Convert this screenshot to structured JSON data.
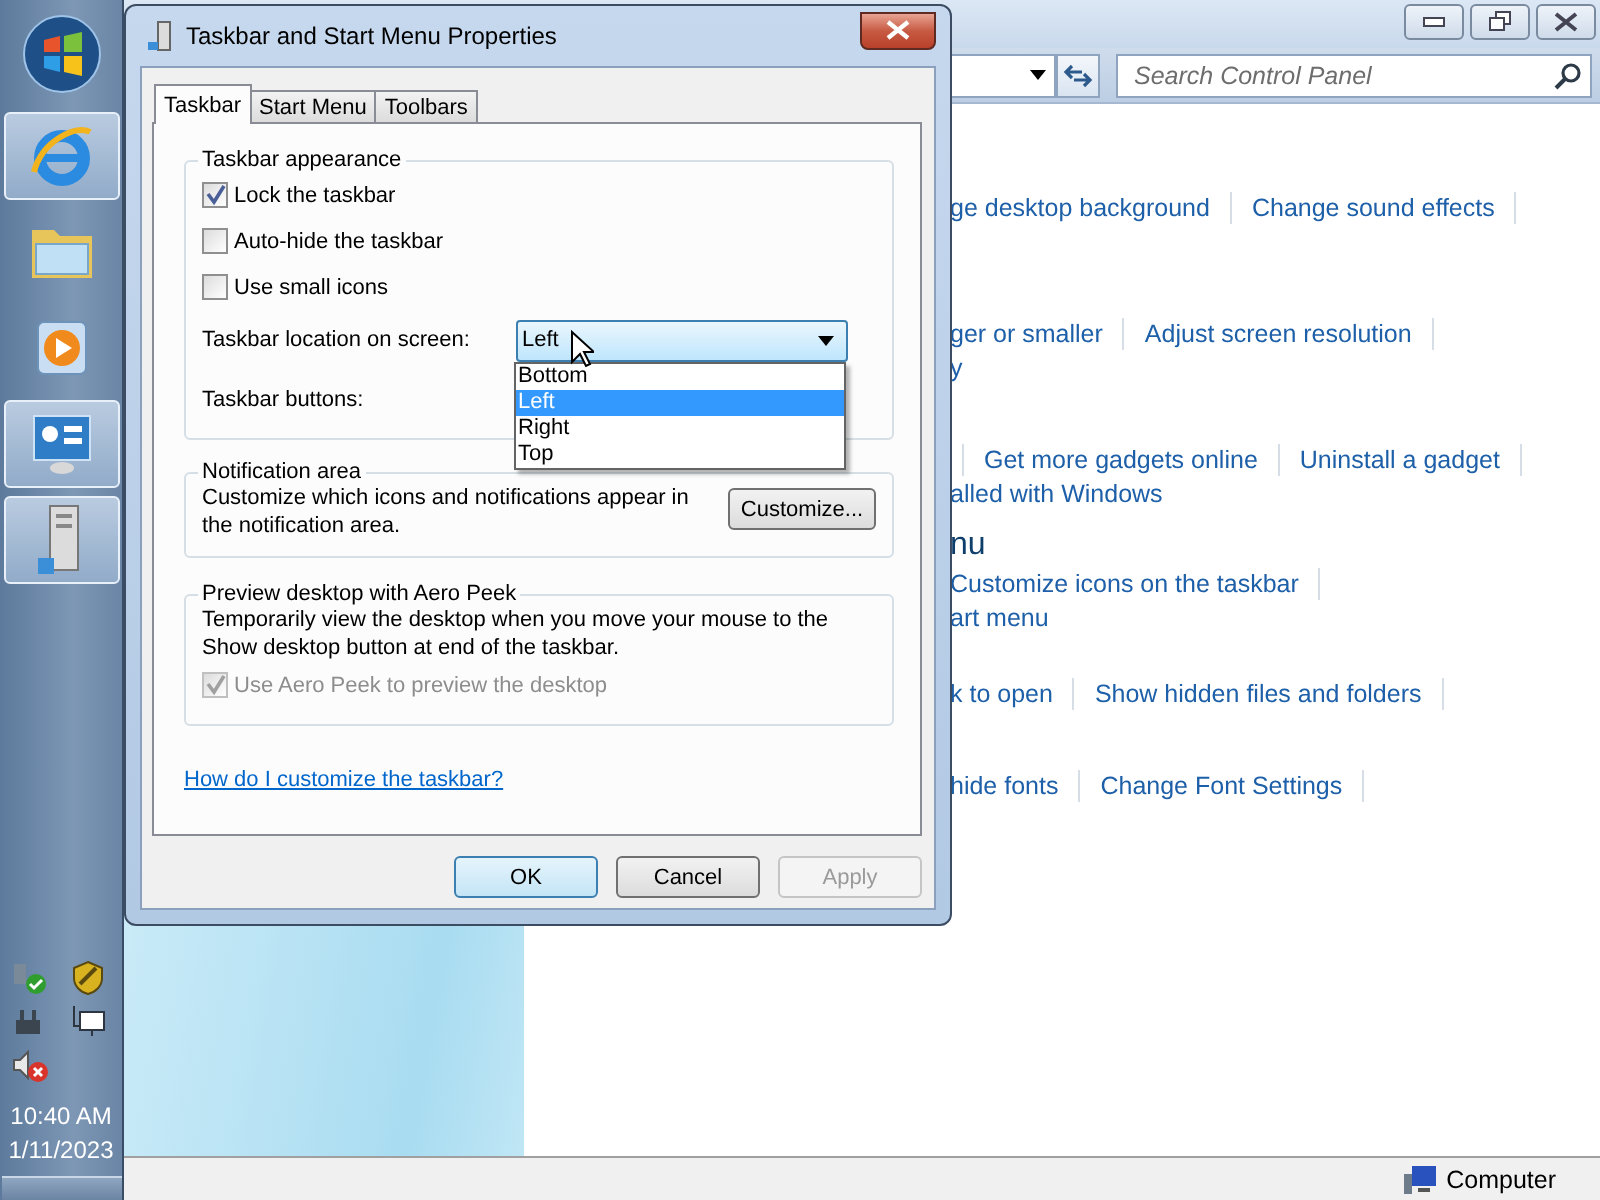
{
  "taskbar": {
    "buttons": [
      {
        "kind": "start",
        "active": false
      },
      {
        "kind": "browser",
        "active": true
      },
      {
        "kind": "folder",
        "active": false
      },
      {
        "kind": "media",
        "active": false
      },
      {
        "kind": "control_panel",
        "active": true
      },
      {
        "kind": "properties",
        "active": true
      }
    ],
    "tray": {
      "icons": [
        {
          "kind": "network_ok"
        },
        {
          "kind": "shield"
        },
        {
          "kind": "device"
        },
        {
          "kind": "monitor"
        },
        {
          "kind": "speaker_muted"
        }
      ],
      "time": "10:40 AM",
      "date": "1/11/2023"
    }
  },
  "control_panel": {
    "search": {
      "placeholder": "Search Control Panel"
    },
    "sections": [
      {
        "lines": [
          {
            "leading_divider": false,
            "items": [
              {
                "text": "ge desktop background",
                "kind": "link"
              },
              {
                "text": "Change sound effects",
                "kind": "link"
              }
            ]
          }
        ]
      },
      {
        "lines": [
          {
            "leading_divider": false,
            "items": [
              {
                "text": "ger or smaller",
                "kind": "link"
              },
              {
                "text": "Adjust screen resolution",
                "kind": "link"
              }
            ]
          },
          {
            "leading_divider": false,
            "items": [
              {
                "text": "y",
                "kind": "text"
              }
            ]
          }
        ]
      },
      {
        "lines": [
          {
            "leading_divider": true,
            "items": [
              {
                "text": "Get more gadgets online",
                "kind": "link"
              },
              {
                "text": "Uninstall a gadget",
                "kind": "link"
              }
            ]
          },
          {
            "leading_divider": false,
            "items": [
              {
                "text": "alled with Windows",
                "kind": "text"
              }
            ]
          }
        ]
      },
      {
        "heading": "nu",
        "lines": [
          {
            "leading_divider": false,
            "items": [
              {
                "text": "Customize icons on the taskbar",
                "kind": "link"
              }
            ]
          },
          {
            "leading_divider": false,
            "items": [
              {
                "text": "art menu",
                "kind": "text"
              }
            ]
          }
        ]
      },
      {
        "lines": [
          {
            "leading_divider": false,
            "items": [
              {
                "text": "k to open",
                "kind": "link"
              },
              {
                "text": "Show hidden files and folders",
                "kind": "link"
              }
            ]
          }
        ]
      },
      {
        "lines": [
          {
            "leading_divider": false,
            "items": [
              {
                "text": "hide fonts",
                "kind": "link"
              },
              {
                "text": "Change Font Settings",
                "kind": "link"
              }
            ]
          }
        ]
      }
    ],
    "status_bar": {
      "location": "Computer"
    }
  },
  "dialog": {
    "title": "Taskbar and Start Menu Properties",
    "tabs": [
      {
        "label": "Taskbar",
        "selected": true
      },
      {
        "label": "Start Menu",
        "selected": false
      },
      {
        "label": "Toolbars",
        "selected": false
      }
    ],
    "appearance": {
      "heading": "Taskbar appearance",
      "options": [
        {
          "label": "Lock the taskbar",
          "checked": true
        },
        {
          "label": "Auto-hide the taskbar",
          "checked": false
        },
        {
          "label": "Use small icons",
          "checked": false
        }
      ],
      "location": {
        "label": "Taskbar location on screen:",
        "value": "Left",
        "expanded": true,
        "options": [
          {
            "label": "Bottom",
            "selected": false
          },
          {
            "label": "Left",
            "selected": true
          },
          {
            "label": "Right",
            "selected": false
          },
          {
            "label": "Top",
            "selected": false
          }
        ]
      },
      "buttons_label": "Taskbar buttons:"
    },
    "notification": {
      "heading": "Notification area",
      "text": "Customize which icons and notifications appear in the notification area.",
      "button": "Customize..."
    },
    "peek": {
      "heading": "Preview desktop with Aero Peek",
      "text": "Temporarily view the desktop when you move your mouse to the Show desktop button at end of the taskbar.",
      "option": {
        "label": "Use Aero Peek to preview the desktop",
        "checked": true,
        "disabled": true
      }
    },
    "help_link": "How do I customize the taskbar?",
    "buttons": [
      {
        "label": "OK",
        "kind": "default"
      },
      {
        "label": "Cancel",
        "kind": "normal"
      },
      {
        "label": "Apply",
        "kind": "disabled"
      }
    ]
  }
}
